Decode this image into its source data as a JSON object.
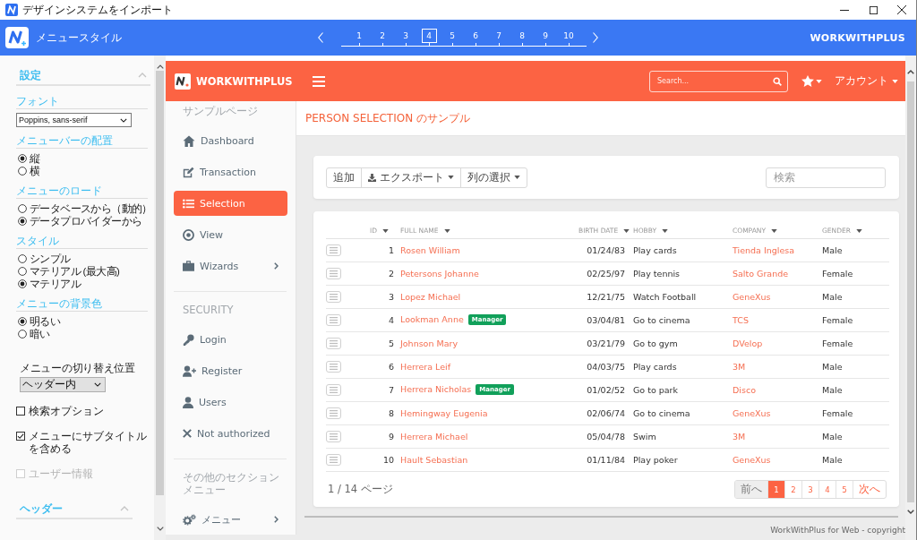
{
  "window": {
    "title": "デザインシステムをインポート"
  },
  "wizard_bar": {
    "title": "メニュースタイル",
    "steps": [
      {
        "label": "1",
        "selected": false
      },
      {
        "label": "2",
        "selected": false
      },
      {
        "label": "3",
        "selected": false
      },
      {
        "label": "4",
        "selected": true
      },
      {
        "label": "5",
        "selected": false
      },
      {
        "label": "6",
        "selected": false
      },
      {
        "label": "7",
        "selected": false
      },
      {
        "label": "8",
        "selected": false
      },
      {
        "label": "9",
        "selected": false
      },
      {
        "label": "10",
        "selected": false
      }
    ],
    "brand": "WORKWITHPLUS"
  },
  "settings_panel": {
    "sections": [
      {
        "title": "設定",
        "expanded": true,
        "items": [
          {
            "kind": "select",
            "label": "フォント",
            "value": "Poppins, sans-serif"
          },
          {
            "kind": "radio_group",
            "label": "メニューバーの配置",
            "options": [
              {
                "label": "縦",
                "selected": true
              },
              {
                "label": "横",
                "selected": false
              }
            ]
          },
          {
            "kind": "radio_group",
            "label": "メニューのロード",
            "options": [
              {
                "label": "データベースから（動的）",
                "selected": false
              },
              {
                "label": "データプロバイダーから",
                "selected": true
              }
            ]
          },
          {
            "kind": "radio_group",
            "label": "スタイル",
            "options": [
              {
                "label": "シンプル",
                "selected": false
              },
              {
                "label": "マテリアル (最大高)",
                "selected": false
              },
              {
                "label": "マテリアル",
                "selected": true
              }
            ]
          },
          {
            "kind": "radio_group",
            "label": "メニューの背景色",
            "options": [
              {
                "label": "明るい",
                "selected": true
              },
              {
                "label": "暗い",
                "selected": false
              }
            ]
          },
          {
            "kind": "dropdown",
            "label": "メニューの切り替え位置",
            "value": "ヘッダー内"
          },
          {
            "kind": "checkbox",
            "label": "検索オプション",
            "checked": false,
            "disabled": false
          },
          {
            "kind": "checkbox",
            "label": "メニューにサブタイトルを含める",
            "checked": true,
            "disabled": false
          },
          {
            "kind": "checkbox",
            "label": "ユーザー情報",
            "checked": false,
            "disabled": true
          }
        ]
      },
      {
        "title": "ヘッダー",
        "expanded": true
      }
    ]
  },
  "preview": {
    "header": {
      "brand": "WORKWITHPLUS",
      "search": {
        "placeholder": "Search..."
      },
      "account": "アカウント"
    },
    "sidebar": {
      "sections": [
        {
          "title": "サンプルページ",
          "items": [
            {
              "label": "Dashboard",
              "selected": false,
              "submenu": false
            },
            {
              "label": "Transaction",
              "selected": false,
              "submenu": false
            },
            {
              "label": "Selection",
              "selected": true,
              "submenu": false
            },
            {
              "label": "View",
              "selected": false,
              "submenu": false
            },
            {
              "label": "Wizards",
              "selected": false,
              "submenu": true
            }
          ]
        },
        {
          "title": "SECURITY",
          "items": [
            {
              "label": "Login",
              "selected": false,
              "submenu": false
            },
            {
              "label": "Register",
              "selected": false,
              "submenu": false
            },
            {
              "label": "Users",
              "selected": false,
              "submenu": false
            },
            {
              "label": "Not authorized",
              "selected": false,
              "submenu": false
            }
          ]
        },
        {
          "title": "その他のセクションメニュー",
          "items": [
            {
              "label": "メニュー",
              "selected": false,
              "submenu": true
            }
          ]
        }
      ]
    },
    "page_title": "PERSON SELECTION のサンプル",
    "toolbar": {
      "buttons": [
        {
          "kind": "plain",
          "label": "追加"
        },
        {
          "kind": "export",
          "label": "エクスポート"
        },
        {
          "kind": "dropdown",
          "label": "列の選択"
        }
      ],
      "search": {
        "placeholder": "検索"
      }
    },
    "table": {
      "columns": [
        "ID",
        "FULL NAME",
        "BIRTH DATE",
        "HOBBY",
        "COMPANY",
        "GENDER"
      ],
      "rows": [
        {
          "id": "1",
          "full_name": "Rosen William",
          "birth_date": "01/24/83",
          "hobby": "Play cards",
          "company": "Tienda Inglesa",
          "gender": "Male"
        },
        {
          "id": "2",
          "full_name": "Petersons Johanne",
          "birth_date": "02/25/97",
          "hobby": "Play tennis",
          "company": "Salto Grande",
          "gender": "Female"
        },
        {
          "id": "3",
          "full_name": "Lopez Michael",
          "birth_date": "12/21/75",
          "hobby": "Watch Football",
          "company": "GeneXus",
          "gender": "Male"
        },
        {
          "id": "4",
          "full_name": "Lookman Anne",
          "badge": "Manager",
          "birth_date": "03/04/81",
          "hobby": "Go to cinema",
          "company": "TCS",
          "gender": "Female"
        },
        {
          "id": "5",
          "full_name": "Johnson Mary",
          "birth_date": "03/21/79",
          "hobby": "Go to gym",
          "company": "DVelop",
          "gender": "Female"
        },
        {
          "id": "6",
          "full_name": "Herrera Leif",
          "birth_date": "04/03/75",
          "hobby": "Play cards",
          "company": "3M",
          "gender": "Male"
        },
        {
          "id": "7",
          "full_name": "Herrera Nicholas",
          "badge": "Manager",
          "birth_date": "01/02/52",
          "hobby": "Go to park",
          "company": "Disco",
          "gender": "Male"
        },
        {
          "id": "8",
          "full_name": "Hemingway Eugenia",
          "birth_date": "02/06/74",
          "hobby": "Go to cinema",
          "company": "GeneXus",
          "gender": "Female"
        },
        {
          "id": "9",
          "full_name": "Herrera Michael",
          "birth_date": "05/04/78",
          "hobby": "Swim",
          "company": "3M",
          "gender": "Male"
        },
        {
          "id": "10",
          "full_name": "Hault Sebastian",
          "birth_date": "01/11/84",
          "hobby": "Play poker",
          "company": "GeneXus",
          "gender": "Male"
        }
      ]
    },
    "pagination": {
      "summary": "1 / 14 ページ",
      "previous": "前へ",
      "pages": [
        {
          "label": "1",
          "selected": true
        },
        {
          "label": "2",
          "selected": false
        },
        {
          "label": "3",
          "selected": false
        },
        {
          "label": "4",
          "selected": false
        },
        {
          "label": "5",
          "selected": false
        }
      ],
      "next": "次へ"
    },
    "footer": "WorkWithPlus for Web - copyright"
  }
}
